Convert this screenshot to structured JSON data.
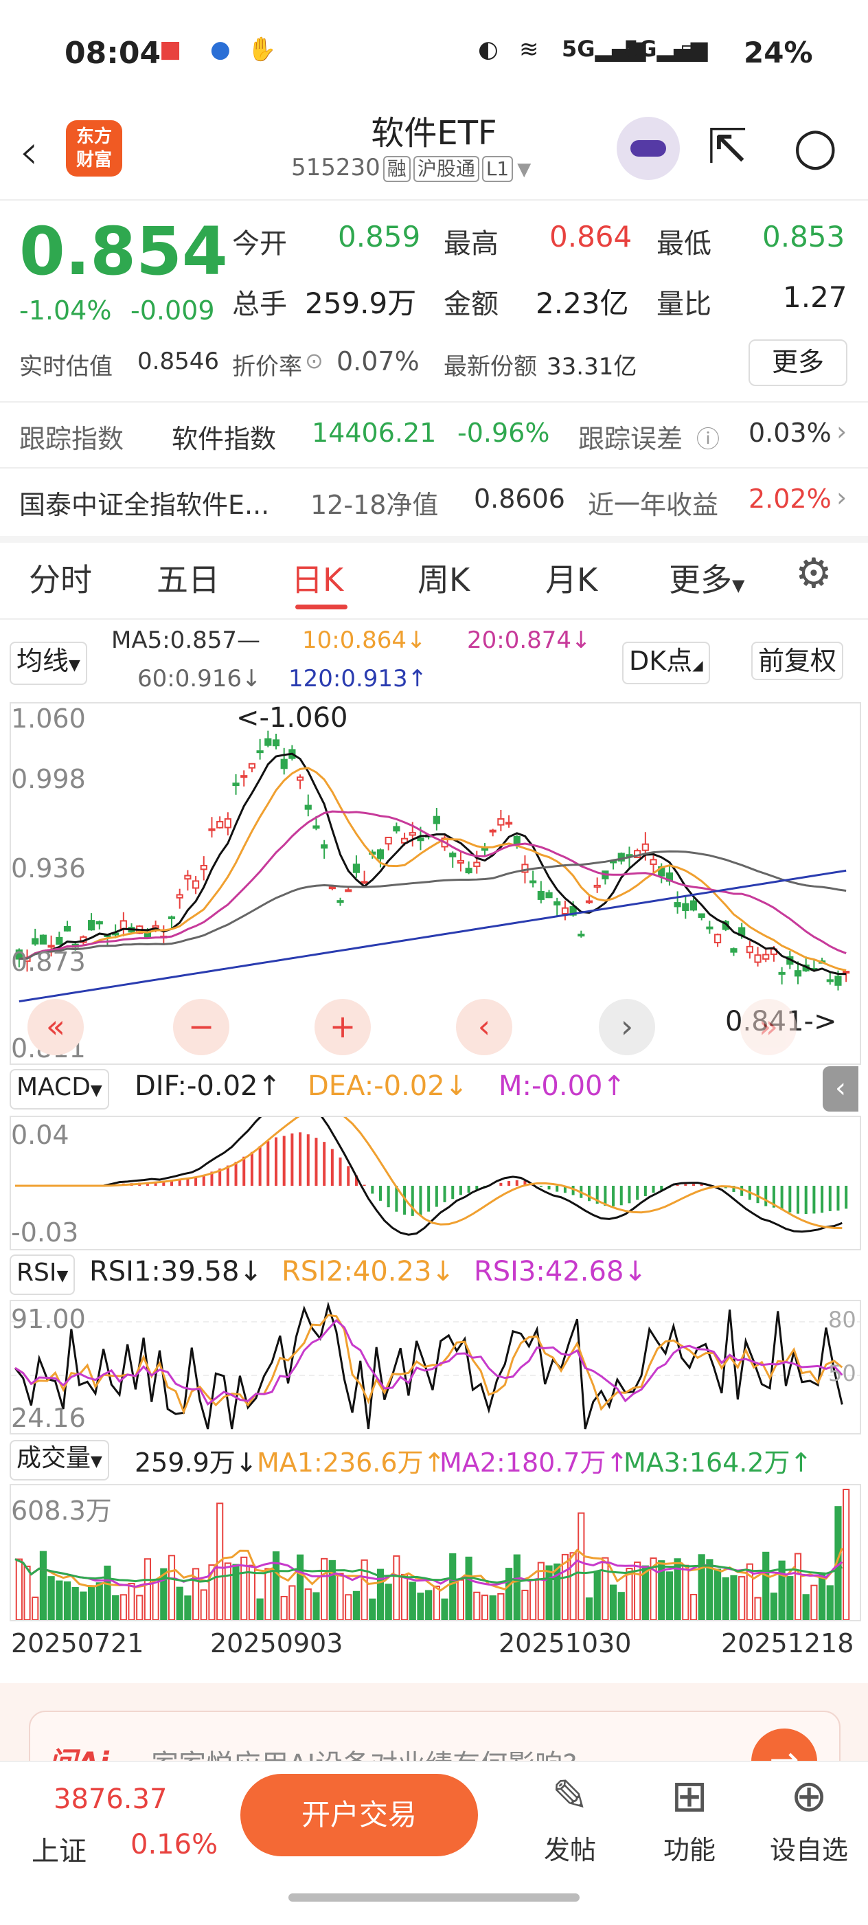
{
  "status_bar": {
    "time": "08:04",
    "battery": "24%",
    "network": "5G"
  },
  "header": {
    "title": "软件ETF",
    "code": "515230",
    "tags": [
      "融",
      "沪股通",
      "L1"
    ]
  },
  "quote": {
    "price": "0.854",
    "change_pct": "-1.04%",
    "change": "-0.009",
    "open_label": "今开",
    "open": "0.859",
    "high_label": "最高",
    "high": "0.864",
    "low_label": "最低",
    "low": "0.853",
    "volume_label": "总手",
    "volume": "259.9万",
    "amount_label": "金额",
    "amount": "2.23亿",
    "ratio_label": "量比",
    "ratio": "1.27",
    "est_label": "实时估值",
    "est": "0.8546",
    "premium_label": "折价率",
    "premium": "0.07%",
    "shares_label": "最新份额",
    "shares": "33.31亿",
    "more": "更多"
  },
  "track": {
    "label": "跟踪指数",
    "index": "软件指数",
    "value": "14406.21",
    "pct": "-0.96%",
    "err_label": "跟踪误差",
    "err": "0.03%"
  },
  "fund": {
    "name": "国泰中证全指软件E...",
    "nav_label": "12-18净值",
    "nav": "0.8606",
    "yr_label": "近一年收益",
    "yr": "2.02%"
  },
  "tabs": [
    "分时",
    "五日",
    "日K",
    "周K",
    "月K",
    "更多"
  ],
  "ma_legend": {
    "selector": "均线",
    "ma5": "MA5:0.857—",
    "ma10": "10:0.864↓",
    "ma20": "20:0.874↓",
    "ma60": "60:0.916↓",
    "ma120": "120:0.913↑",
    "dk": "DK点",
    "adj": "前复权"
  },
  "kline": {
    "y_labels": [
      "1.060",
      "0.998",
      "0.936",
      "0.873",
      "0.811"
    ],
    "high_note": "<-1.060",
    "low_note": "0.841->"
  },
  "macd": {
    "selector": "MACD",
    "dif": "DIF:-0.02↑",
    "dea": "DEA:-0.02↓",
    "m": "M:-0.00↑",
    "y_top": "0.04",
    "y_bot": "-0.03"
  },
  "rsi": {
    "selector": "RSI",
    "rsi1": "RSI1:39.58↓",
    "rsi2": "RSI2:40.23↓",
    "rsi3": "RSI3:42.68↓",
    "y_top": "91.00",
    "y_bot": "24.16",
    "r80": "80",
    "r50": "50"
  },
  "vol": {
    "selector": "成交量",
    "v": "259.9万↓",
    "ma1": "MA1:236.6万↑",
    "ma2": "MA2:180.7万↑",
    "ma3": "MA3:164.2万↑",
    "y_top": "608.3万"
  },
  "dates": [
    "20250721",
    "20250903",
    "20251030",
    "20251218"
  ],
  "ai": {
    "brand": "问Ai",
    "question": "家家悦应用AI设备对业绩有何影响?"
  },
  "bottom": {
    "index_value": "3876.37",
    "index_name": "上证",
    "index_pct": "0.16%",
    "trade": "开户交易",
    "post": "发帖",
    "func": "功能",
    "watch": "设自选"
  },
  "colors": {
    "up": "#e8423f",
    "down": "#2fa84f",
    "ma10": "#f0a030",
    "ma20": "#c73a9a",
    "ma120": "#2a3cb0"
  }
}
